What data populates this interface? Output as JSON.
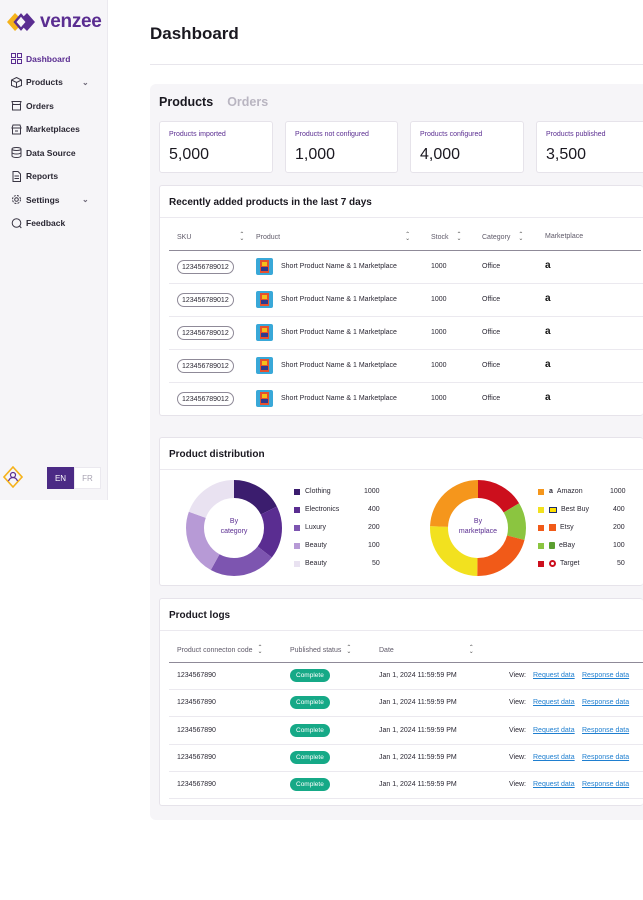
{
  "brand": {
    "name": "venzee"
  },
  "sidebar": {
    "items": [
      {
        "label": "Dashboard",
        "icon": "grid-icon"
      },
      {
        "label": "Products",
        "icon": "box-icon"
      },
      {
        "label": "Orders",
        "icon": "cart-icon"
      },
      {
        "label": "Marketplaces",
        "icon": "store-icon"
      },
      {
        "label": "Data Source",
        "icon": "database-icon"
      },
      {
        "label": "Reports",
        "icon": "document-icon"
      },
      {
        "label": "Settings",
        "icon": "gear-icon"
      },
      {
        "label": "Feedback",
        "icon": "chat-icon"
      }
    ],
    "lang_en": "EN",
    "lang_fr": "FR"
  },
  "header": {
    "title": "Dashboard"
  },
  "tabs": {
    "products": "Products",
    "orders": "Orders"
  },
  "stats": [
    {
      "label": "Products imported",
      "value": "5,000"
    },
    {
      "label": "Products not configured",
      "value": "1,000"
    },
    {
      "label": "Products configured",
      "value": "4,000"
    },
    {
      "label": "Products published",
      "value": "3,500"
    }
  ],
  "recent": {
    "title": "Recently added products in the last 7 days",
    "columns": [
      "SKU",
      "Product",
      "Stock",
      "Category",
      "Marketplace"
    ],
    "rows": [
      {
        "sku": "123456789012",
        "product": "Short Product Name & 1 Marketplace",
        "stock": "1000",
        "category": "Office",
        "marketplace": "a"
      },
      {
        "sku": "123456789012",
        "product": "Short Product Name & 1 Marketplace",
        "stock": "1000",
        "category": "Office",
        "marketplace": "a"
      },
      {
        "sku": "123456789012",
        "product": "Short Product Name & 1 Marketplace",
        "stock": "1000",
        "category": "Office",
        "marketplace": "a"
      },
      {
        "sku": "123456789012",
        "product": "Short Product Name & 1 Marketplace",
        "stock": "1000",
        "category": "Office",
        "marketplace": "a"
      },
      {
        "sku": "123456789012",
        "product": "Short Product Name & 1 Marketplace",
        "stock": "1000",
        "category": "Office",
        "marketplace": "a"
      }
    ]
  },
  "distribution": {
    "title": "Product distribution",
    "category_label_1": "By",
    "category_label_2": "category",
    "marketplace_label_1": "By",
    "marketplace_label_2": "marketplace",
    "category_legend": [
      {
        "name": "Clothing",
        "value": "1000",
        "color": "#3b1d6e"
      },
      {
        "name": "Electronics",
        "value": "400",
        "color": "#5a2d91"
      },
      {
        "name": "Luxury",
        "value": "200",
        "color": "#7d55b0"
      },
      {
        "name": "Beauty",
        "value": "100",
        "color": "#b79ad6"
      },
      {
        "name": "Beauty",
        "value": "50",
        "color": "#e9e2f1"
      }
    ],
    "marketplace_legend": [
      {
        "name": "Amazon",
        "value": "1000",
        "color": "#f5961c"
      },
      {
        "name": "Best Buy",
        "value": "400",
        "color": "#f2e11f"
      },
      {
        "name": "Etsy",
        "value": "200",
        "color": "#f15a18"
      },
      {
        "name": "eBay",
        "value": "100",
        "color": "#8bc540"
      },
      {
        "name": "Target",
        "value": "50",
        "color": "#cc0f1d"
      }
    ]
  },
  "logs": {
    "title": "Product logs",
    "columns": [
      "Product connecton code",
      "Published status",
      "Date"
    ],
    "view_label": "View:",
    "request_label": "Request data",
    "response_label": "Response data",
    "rows": [
      {
        "code": "1234567890",
        "status": "Complete",
        "date": "Jan 1, 2024 11:59:59 PM"
      },
      {
        "code": "1234567890",
        "status": "Complete",
        "date": "Jan 1, 2024 11:59:59 PM"
      },
      {
        "code": "1234567890",
        "status": "Complete",
        "date": "Jan 1, 2024 11:59:59 PM"
      },
      {
        "code": "1234567890",
        "status": "Complete",
        "date": "Jan 1, 2024 11:59:59 PM"
      },
      {
        "code": "1234567890",
        "status": "Complete",
        "date": "Jan 1, 2024 11:59:59 PM"
      }
    ]
  }
}
